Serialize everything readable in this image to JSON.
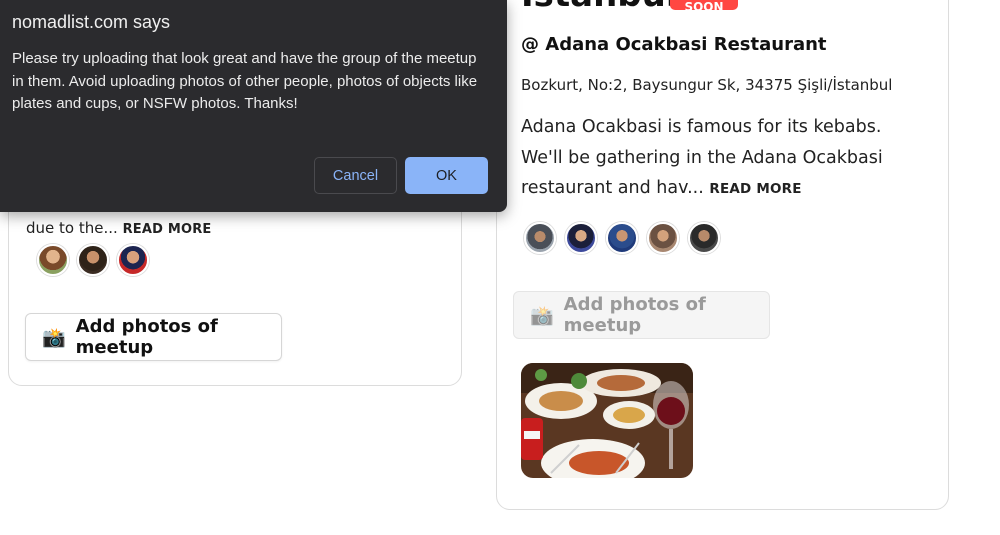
{
  "dialog": {
    "title": "nomadlist.com says",
    "message": "Please try uploading that look great and have the group of the meetup in them. Avoid uploading photos of other people, photos of objects like plates and cups, or NSFW photos. Thanks!",
    "cancel_label": "Cancel",
    "ok_label": "OK"
  },
  "left_card": {
    "description_truncated": "due to the...",
    "read_more": "READ MORE",
    "add_photos_label": "Add photos of meetup",
    "camera_icon": "📸"
  },
  "right_card": {
    "city_title": "Istanbul",
    "badge": "SOON",
    "venue": "@ Adana Ocakbasi Restaurant",
    "address": "Bozkurt, No:2, Baysungur Sk, 34375 Şişli/İstanbul",
    "description": "Adana Ocakbasi is famous for its kebabs. We'll be gathering in the Adana Ocakbasi restaurant and hav...",
    "read_more": "READ MORE",
    "add_photos_label": "Add photos of meetup",
    "camera_icon": "📸"
  },
  "colors": {
    "badge_red": "#ff4742",
    "dialog_bg": "#2b2b2e",
    "dialog_accent": "#8ab4f8"
  }
}
